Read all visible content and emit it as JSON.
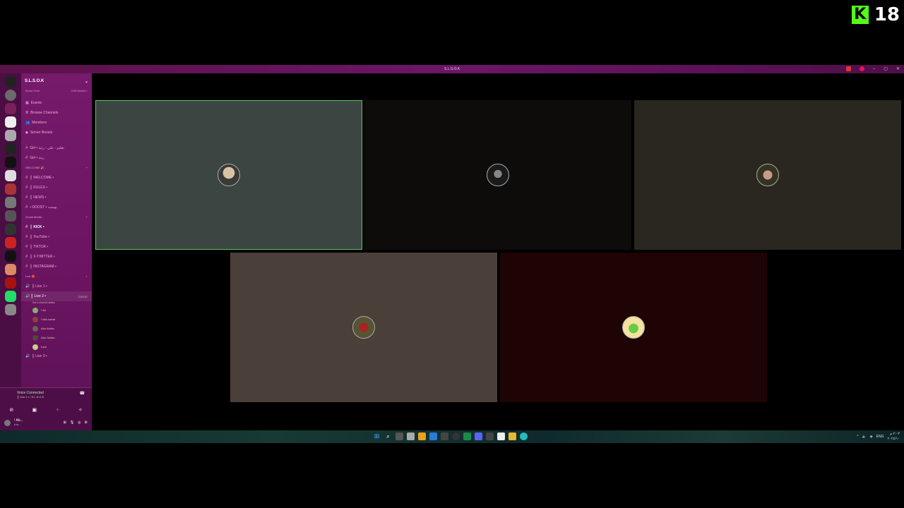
{
  "overlay": {
    "kick_letter": "K",
    "rating": "18"
  },
  "window": {
    "title": "S.L.S.O.K",
    "controls": [
      "–",
      "▢",
      "✕"
    ]
  },
  "server": {
    "name": "S.L.S.O.K",
    "boost_goal": "Boost Goal",
    "boost_count": "0/28 Boosts ›"
  },
  "top_items": [
    {
      "label": "Events",
      "icon": "calendar-icon"
    },
    {
      "label": "Browse Channels",
      "icon": "channels-icon"
    },
    {
      "label": "Members",
      "icon": "members-icon"
    },
    {
      "label": "Server Boosts",
      "icon": "boost-icon"
    }
  ],
  "channels_top": [
    {
      "label": "Girl • تقليم - علي - رتبة",
      "prefix": "#"
    },
    {
      "label": "Girl • رتبة",
      "prefix": "#"
    }
  ],
  "welcome_category": "WELCOME 🎉 -",
  "welcome_channels": [
    {
      "label": "║ WELCOME •",
      "prefix": "#"
    },
    {
      "label": "║ RULES •",
      "prefix": "#"
    },
    {
      "label": "║ NEWS •",
      "prefix": "#"
    },
    {
      "label": "• DOOST • بوست",
      "prefix": "#"
    }
  ],
  "social_category": "Social Media -",
  "social_channels": [
    {
      "label": "║ KICK •",
      "prefix": "#"
    },
    {
      "label": "║ YouTube •",
      "prefix": "#"
    },
    {
      "label": "║ TIKTOK •",
      "prefix": "#"
    },
    {
      "label": "║ X-TWITTER •",
      "prefix": "#"
    },
    {
      "label": "║ INSTAGRAM •",
      "prefix": "#"
    }
  ],
  "live_category": "Live 🔴 -",
  "live_channels": [
    {
      "label": "║ Live 1 •",
      "time": ""
    },
    {
      "label": "║ Live 2 •",
      "time": "2:03:37"
    }
  ],
  "live_status": "Set a channel status",
  "voice_users": [
    "! Ab",
    "! Abu sama",
    "Abu Amira",
    "Abu Sultan",
    "Lam"
  ],
  "live3": "║ Live 3 •",
  "voice_panel": {
    "status": "Voice Connected",
    "sub": "║ Live 2 • / S.L.S.O.K"
  },
  "user": {
    "name": "! Ab...",
    "status": "# In..."
  },
  "tiles": [
    {
      "id": "tile-1",
      "color": "#3b4542",
      "speaking": true
    },
    {
      "id": "tile-2",
      "color": "#0e0b0b",
      "speaking": false
    },
    {
      "id": "tile-3",
      "color": "#2a2620",
      "speaking": false
    },
    {
      "id": "tile-4",
      "color": "#4a3f39",
      "speaking": false
    },
    {
      "id": "tile-5",
      "color": "#1e0404",
      "speaking": false
    }
  ],
  "tray": {
    "lang": "ENG",
    "time": "٢:٠٣ م",
    "date": "٢٠٢٤/١٠"
  }
}
